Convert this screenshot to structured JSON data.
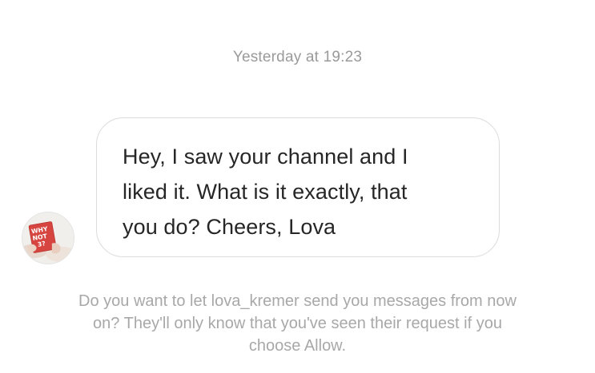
{
  "thread": {
    "timestamp": "Yesterday at 19:23"
  },
  "message": {
    "lines": [
      "Hey, I saw your channel and I",
      "liked it. What is it exactly, that",
      "you do? Cheers, Lova"
    ],
    "avatar": {
      "icon": "profile-photo-avatar",
      "photo_text": [
        "WHY",
        "NOT",
        "3?"
      ]
    }
  },
  "request": {
    "lines": [
      "Do you want to let lova_kremer send you messages from now",
      "on? They'll only know that you've seen their request if you",
      "choose Allow."
    ]
  },
  "colors": {
    "background": "#ffffff",
    "bubble_border": "#dbdbdb",
    "message_text": "#262626",
    "secondary_text": "#9a9a9a",
    "avatar_red": "#d6453f"
  }
}
